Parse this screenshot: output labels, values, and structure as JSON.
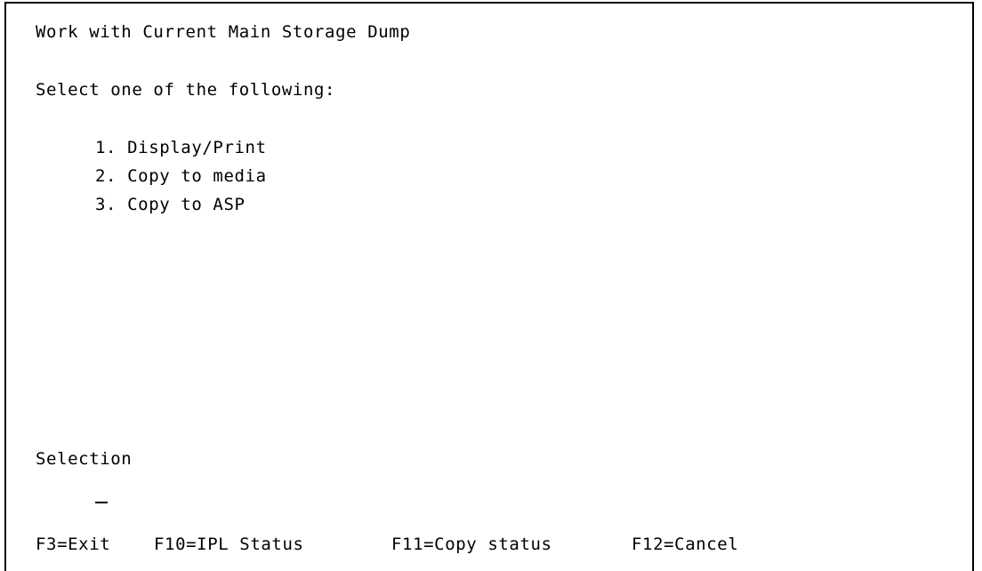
{
  "screen": {
    "title": "Work with Current Main Storage Dump",
    "prompt": "Select one of the following:",
    "options": [
      {
        "label": "1. Display/Print"
      },
      {
        "label": "2. Copy to media"
      },
      {
        "label": "3. Copy to ASP"
      }
    ],
    "selection_label": "Selection",
    "selection_value": ""
  },
  "function_keys": [
    {
      "label": "F3=Exit"
    },
    {
      "label": "F10=IPL Status"
    },
    {
      "label": "F11=Copy status"
    },
    {
      "label": "F12=Cancel"
    }
  ],
  "colors": {
    "foreground": "#000000",
    "background": "#ffffff"
  }
}
